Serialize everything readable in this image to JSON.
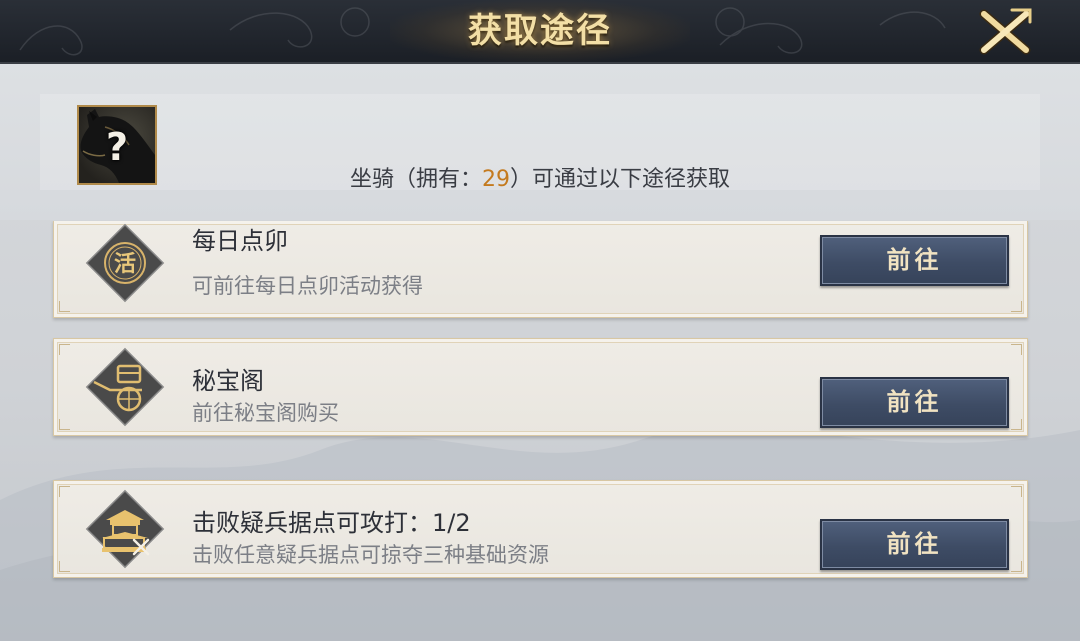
{
  "dialog": {
    "title": "获取途径"
  },
  "summary": {
    "item_name_prefix": "坐骑（拥有：",
    "owned_count": "29",
    "suffix": "）可通过以下途径获取",
    "item_icon": "horse-mount-icon"
  },
  "sources": [
    {
      "title": "每日点卯",
      "description": "可前往每日点卯活动获得",
      "badge_icon": "activity-seal-icon",
      "badge_glyph": "活",
      "button_label": "前往"
    },
    {
      "title": "秘宝阁",
      "description": "前往秘宝阁购买",
      "badge_icon": "merchant-cart-icon",
      "button_label": "前往"
    },
    {
      "title": "击败疑兵据点可攻打：1/2",
      "description": "击败任意疑兵据点可掠夺三种基础资源",
      "badge_icon": "fortress-crossed-swords-icon",
      "button_label": "前往"
    }
  ],
  "colors": {
    "header_bg": "#1f232a",
    "title_gold": "#f3dfa6",
    "count_orange": "#c47a1f",
    "button_blue": "#435069",
    "card_bg": "#ece9e3"
  }
}
